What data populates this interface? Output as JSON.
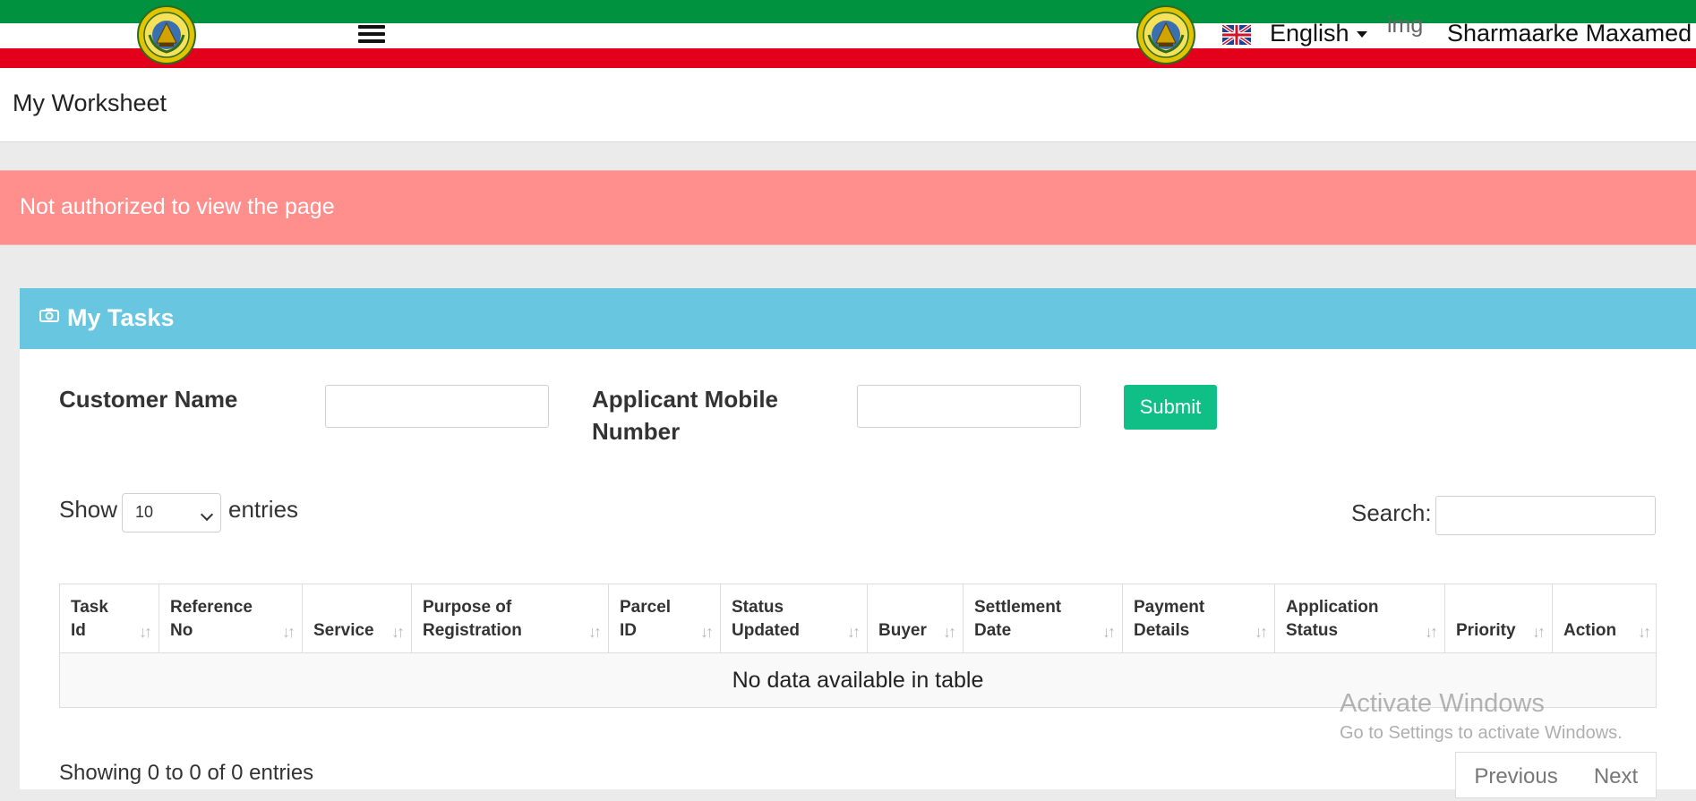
{
  "header": {
    "language": "English",
    "img_placeholder": "img",
    "username": "Sharmaarke Maxamed"
  },
  "page": {
    "title": "My Worksheet"
  },
  "alert": {
    "message": "Not authorized to view the page"
  },
  "panel": {
    "title": "My Tasks"
  },
  "filters": {
    "customer_name_label": "Customer Name",
    "applicant_mobile_label_line1": "Applicant Mobile",
    "applicant_mobile_label_line2": "Number",
    "submit_label": "Submit"
  },
  "table_controls": {
    "show_label": "Show",
    "entries_label": "entries",
    "page_size": "10",
    "search_label": "Search:"
  },
  "table": {
    "columns": [
      [
        "Task",
        "Id"
      ],
      [
        "Reference",
        "No"
      ],
      [
        "",
        "Service"
      ],
      [
        "Purpose of",
        "Registration"
      ],
      [
        "Parcel",
        "ID"
      ],
      [
        "Status",
        "Updated"
      ],
      [
        "",
        "Buyer"
      ],
      [
        "Settlement",
        "Date"
      ],
      [
        "Payment",
        "Details"
      ],
      [
        "Application",
        "Status"
      ],
      [
        "",
        "Priority"
      ],
      [
        "",
        "Action"
      ]
    ],
    "empty_message": "No data available in table",
    "info": "Showing 0 to 0 of 0 entries",
    "previous_label": "Previous",
    "next_label": "Next"
  },
  "watermark": {
    "line1": "Activate Windows",
    "line2": "Go to Settings to activate Windows."
  },
  "colors": {
    "flag_green": "#00923f",
    "flag_red": "#e3001b",
    "panel_header": "#69c6e0",
    "alert": "#ff8f8d",
    "submit": "#0fbf86"
  },
  "icons": [
    "emblem-icon",
    "hamburger-menu-icon",
    "uk-flag-icon",
    "camera-icon",
    "sort-icon"
  ]
}
